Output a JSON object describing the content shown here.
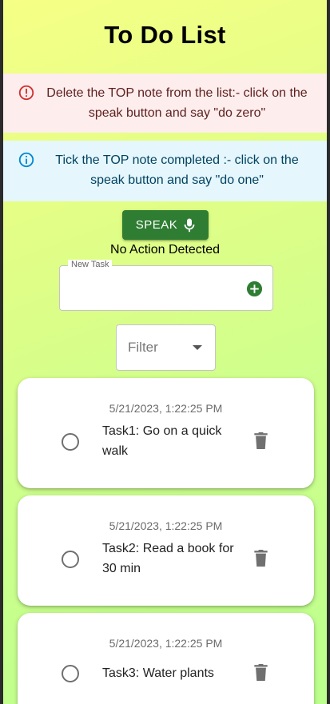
{
  "app": {
    "title": "To Do List"
  },
  "alerts": {
    "error": {
      "icon": "error-outline-icon",
      "color": "#d32f2f",
      "background": "#fdeded",
      "text": "Delete the TOP note from the list:- click on the speak button and say \"do zero\""
    },
    "info": {
      "icon": "info-outline-icon",
      "color": "#0288d1",
      "background": "#e5f6fd",
      "text": "Tick the TOP note completed :- click on the speak button and say \"do one\""
    }
  },
  "speak": {
    "label": "SPEAK",
    "icon": "microphone-icon",
    "color": "#2e7d32"
  },
  "status": {
    "text": "No Action Detected"
  },
  "new_task": {
    "label": "New Task",
    "value": "",
    "add_icon": "add-circle-icon",
    "add_color": "#2e7d32"
  },
  "filter": {
    "placeholder": "Filter",
    "icon": "arrow-drop-down-icon"
  },
  "tasks": [
    {
      "timestamp": "5/21/2023, 1:22:25 PM",
      "title": "Task1: Go on a quick walk",
      "completed": false
    },
    {
      "timestamp": "5/21/2023, 1:22:25 PM",
      "title": "Task2: Read a book for 30 min",
      "completed": false
    },
    {
      "timestamp": "5/21/2023, 1:22:25 PM",
      "title": "Task3: Water plants",
      "completed": false
    }
  ]
}
